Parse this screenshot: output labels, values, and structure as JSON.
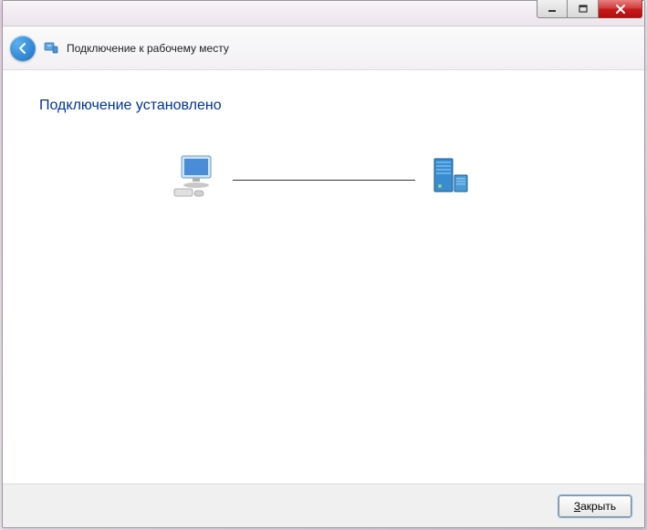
{
  "titlebar": {
    "minimize_glyph": "─",
    "maximize_glyph": "☐",
    "close_glyph": "X"
  },
  "header": {
    "title": "Подключение к рабочему месту"
  },
  "content": {
    "heading": "Подключение установлено"
  },
  "footer": {
    "close_label_first": "З",
    "close_label_rest": "акрыть"
  },
  "colors": {
    "heading": "#003399",
    "back_btn": "#1b6fc4"
  }
}
